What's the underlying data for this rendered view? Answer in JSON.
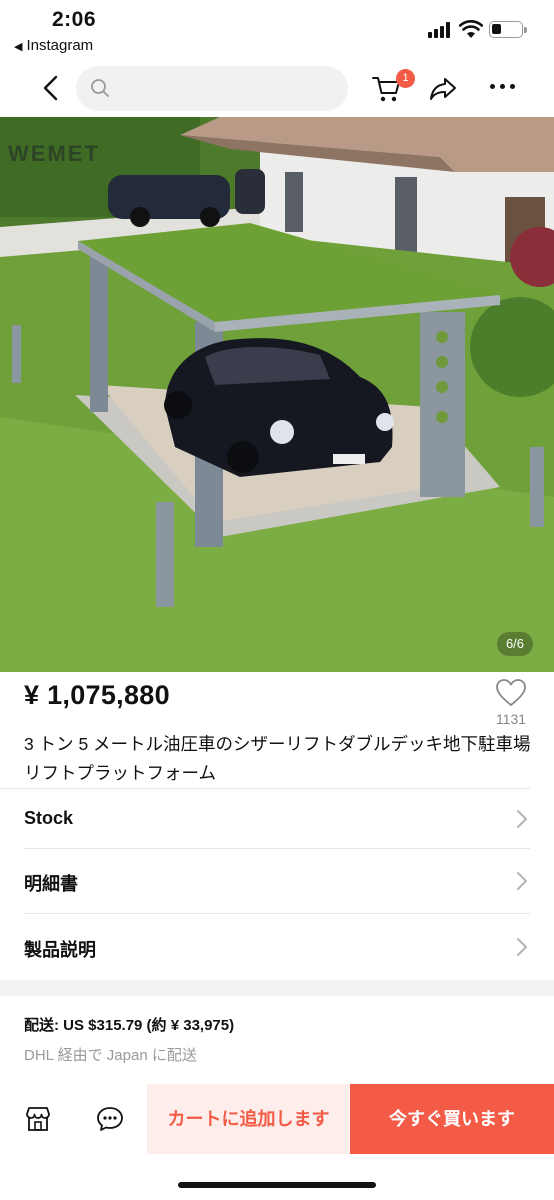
{
  "status_bar": {
    "time": "2:06",
    "back_app": "Instagram",
    "back_arrow": "◀"
  },
  "nav": {
    "back_icon": "chevron-left-icon",
    "search_placeholder": "",
    "cart_icon": "cart-icon",
    "cart_badge": "1",
    "share_icon": "share-icon",
    "more_icon": "more-icon"
  },
  "hero": {
    "watermark": "WEMET",
    "image_counter": "6/6"
  },
  "product": {
    "price": "¥ 1,075,880",
    "likes": "1131",
    "title": "3 トン 5 メートル油圧車のシザーリフトダブルデッキ地下駐車場リフトプラットフォーム"
  },
  "rows": [
    {
      "label": "Stock"
    },
    {
      "label": "明細書"
    },
    {
      "label": "製品説明"
    }
  ],
  "shipping": {
    "main": "配送: US $315.79 (約 ¥ 33,975)",
    "sub": "DHL 経由で Japan に配送"
  },
  "bottom_bar": {
    "store_icon": "store-icon",
    "chat_icon": "chat-icon",
    "add_to_cart": "カートに追加します",
    "buy_now": "今すぐ買います"
  },
  "colors": {
    "accent": "#f35b46",
    "accent_light": "#fdeeec"
  }
}
